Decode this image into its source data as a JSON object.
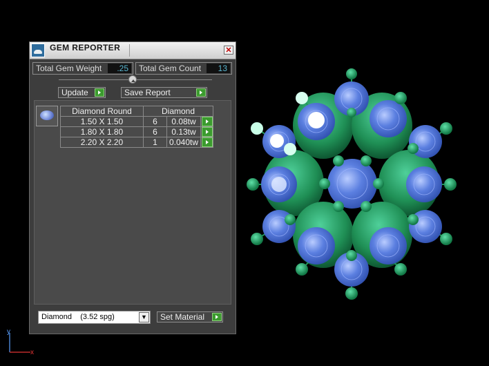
{
  "window": {
    "title": "GEM REPORTER",
    "close_glyph": "✕"
  },
  "stats": {
    "weight_label": "Total Gem Weight",
    "weight_value": ".25",
    "count_label": "Total Gem Count",
    "count_value": "13"
  },
  "toolbar": {
    "update_label": "Update",
    "save_label": "Save Report"
  },
  "table": {
    "headers": [
      "Diamond Round",
      "Diamond"
    ],
    "rows": [
      {
        "size": "1.50 X 1.50",
        "count": "6",
        "weight": "0.08tw"
      },
      {
        "size": "1.80 X 1.80",
        "count": "6",
        "weight": "0.13tw"
      },
      {
        "size": "2.20 X 2.20",
        "count": "1",
        "weight": "0.040tw"
      }
    ]
  },
  "material": {
    "selected": "Diamond    (3.52 spg)",
    "set_label": "Set Material"
  },
  "axis": {
    "y_label": "y",
    "x_label": "x"
  },
  "colors": {
    "gem_blue": "#5b7fe0",
    "prong_green": "#1f8f55",
    "value_cyan": "#59b6d1",
    "accent_green": "#3b9b2e"
  },
  "icons": {
    "app": "gem-reporter-app-icon",
    "close": "close-icon",
    "expand": "play-arrow-icon",
    "dropdown": "chevron-down-icon"
  }
}
